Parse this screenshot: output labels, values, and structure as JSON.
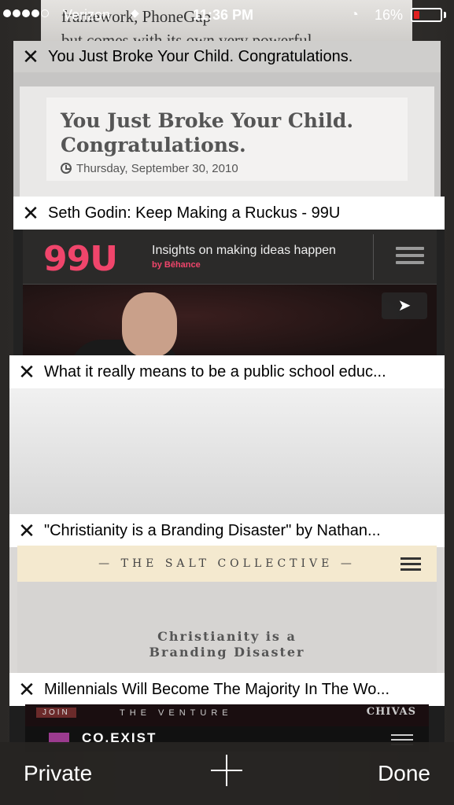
{
  "status_bar": {
    "carrier": "Verizon",
    "time": "11:36 PM",
    "battery_percent": "16%",
    "battery_level": 0.16,
    "signal_bars_filled": 4,
    "signal_bars_total": 5
  },
  "background_tab": {
    "text_lines": [
      "framework, PhoneGap",
      "but comes with its own very powerful"
    ]
  },
  "tabs": [
    {
      "title": "You Just Broke Your Child. Congratulations.",
      "close_glyph": "✕",
      "page": {
        "headline": "You Just Broke Your Child. Congratulations.",
        "date": "Thursday, September 30, 2010"
      }
    },
    {
      "title": "Seth Godin: Keep Making a Ruckus - 99U",
      "close_glyph": "✕",
      "page": {
        "logo": "99U",
        "tagline": "Insights on making ideas happen",
        "byline": "by Bēhance",
        "share_icon": "paper-plane-icon"
      }
    },
    {
      "title": "What it really means to be a public school educ...",
      "close_glyph": "✕"
    },
    {
      "title": "\"Christianity is a Branding Disaster\" by Nathan...",
      "close_glyph": "✕",
      "page": {
        "site_name": "— THE SALT COLLECTIVE —",
        "headline_line1": "Christianity is a",
        "headline_line2": "Branding Disaster"
      }
    },
    {
      "title": "Millennials Will Become The Majority In The Wo...",
      "close_glyph": "✕",
      "page": {
        "ad_join": "JOIN",
        "ad_venture": "THE VENTURE",
        "ad_brand": "CHIVAS",
        "site_logo": "CO.EXIST"
      }
    }
  ],
  "toolbar": {
    "private_label": "Private",
    "add_icon": "plus-icon",
    "done_label": "Done"
  },
  "colors": {
    "accent_99u": "#f0456b",
    "battery_low": "#e02020",
    "salt_banner": "#f4e9cf"
  }
}
